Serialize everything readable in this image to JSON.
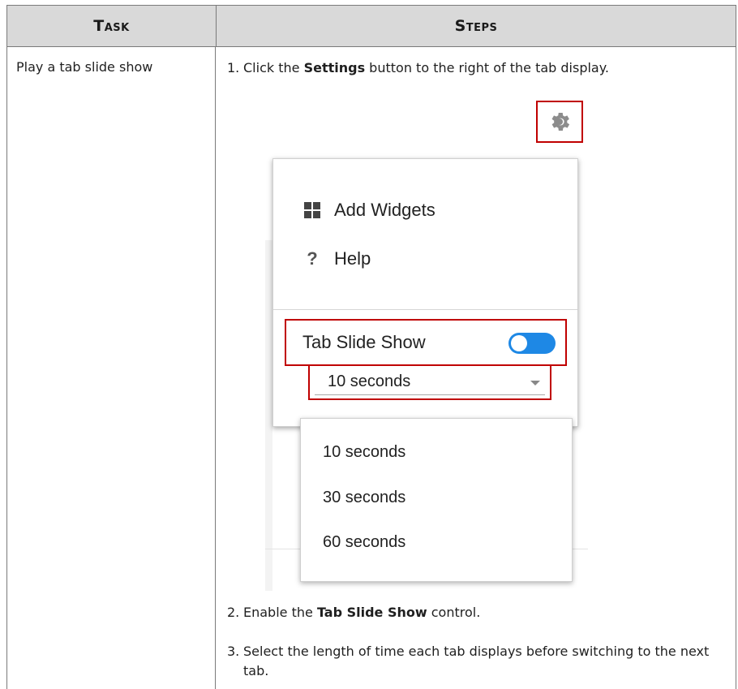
{
  "table": {
    "header": {
      "task": "Task",
      "steps": "Steps"
    },
    "row": {
      "task": "Play a tab slide show",
      "steps": [
        {
          "num": "1.",
          "pre": "Click the ",
          "bold": "Settings",
          "post": " button to the right of the tab display."
        },
        {
          "num": "2.",
          "pre": "Enable the ",
          "bold": "Tab Slide Show",
          "post": " control."
        },
        {
          "num": "3.",
          "pre": "Select the length of time each tab displays before switching to the next tab.",
          "bold": "",
          "post": ""
        }
      ]
    }
  },
  "screenshot": {
    "gear_icon": "gear-icon",
    "menu": {
      "items": [
        {
          "label": "Add Widgets",
          "icon": "grid-icon"
        },
        {
          "label": "Help",
          "icon": "question-icon",
          "glyph": "?"
        }
      ],
      "toggle": {
        "label": "Tab Slide Show",
        "state": "on"
      },
      "select": {
        "value": "10 seconds"
      },
      "options": [
        "10 seconds",
        "30 seconds",
        "60 seconds"
      ]
    },
    "colors": {
      "highlight": "#c00000",
      "toggle_on": "#1e88e5",
      "header_bg": "#d9d9d9"
    }
  }
}
